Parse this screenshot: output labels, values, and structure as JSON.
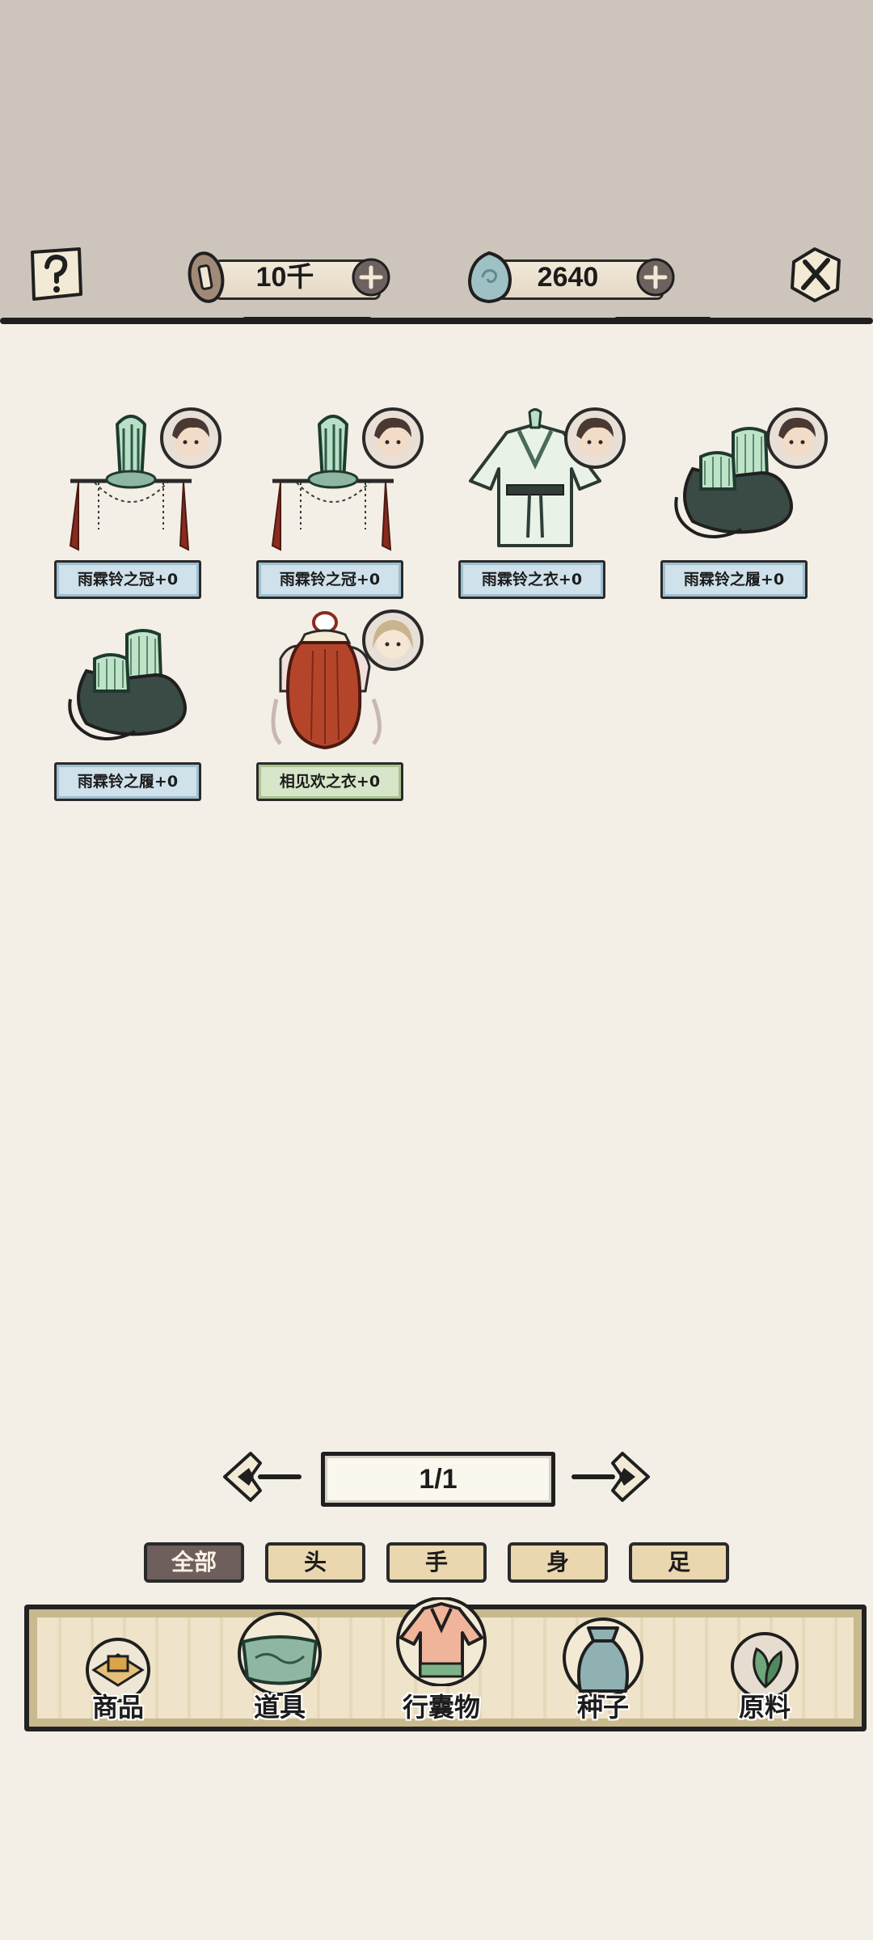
{
  "header": {
    "help_icon": "question-mark-icon",
    "close_icon": "close-x-icon",
    "copper_coins": {
      "value": "10千",
      "icon": "copper-coin-icon"
    },
    "jade": {
      "value": "2640",
      "icon": "jade-stone-icon"
    }
  },
  "items": [
    {
      "name": "雨霖铃之冠+0",
      "type": "crown",
      "label_color": "blue",
      "avatar": "male-character"
    },
    {
      "name": "雨霖铃之冠+0",
      "type": "crown",
      "label_color": "blue",
      "avatar": "male-character"
    },
    {
      "name": "雨霖铃之衣+0",
      "type": "robe",
      "label_color": "blue",
      "avatar": "male-character"
    },
    {
      "name": "雨霖铃之履+0",
      "type": "boots",
      "label_color": "blue",
      "avatar": "male-character"
    },
    {
      "name": "雨霖铃之履+0",
      "type": "boots",
      "label_color": "blue",
      "avatar": null
    },
    {
      "name": "相见欢之衣+0",
      "type": "wig-robe",
      "label_color": "green",
      "avatar": "female-character"
    }
  ],
  "pager": {
    "text": "1/1"
  },
  "filters": [
    {
      "label": "全部",
      "active": true
    },
    {
      "label": "头",
      "active": false
    },
    {
      "label": "手",
      "active": false
    },
    {
      "label": "身",
      "active": false
    },
    {
      "label": "足",
      "active": false
    }
  ],
  "bottom_nav": [
    {
      "label": "商品",
      "icon": "goods-icon"
    },
    {
      "label": "道具",
      "icon": "props-icon"
    },
    {
      "label": "行囊物",
      "icon": "garment-icon",
      "active": true
    },
    {
      "label": "种子",
      "icon": "seed-bag-icon"
    },
    {
      "label": "原料",
      "icon": "leaf-material-icon"
    }
  ],
  "colors": {
    "background": "#f3efe6",
    "top_band": "#cdc5bb",
    "label_blue": "#cfe1ea",
    "label_green": "#d7e6c8",
    "active_tab": "#6e5e5c"
  }
}
